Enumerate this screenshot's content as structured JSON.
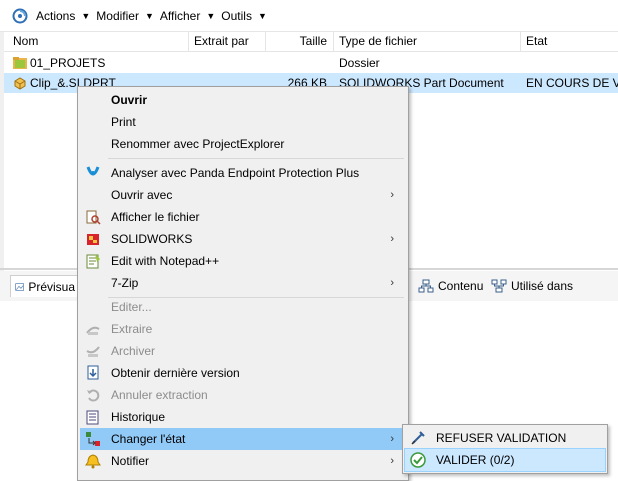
{
  "toolbar": {
    "app_icon": "vault-app-icon",
    "menus": [
      {
        "label": "Actions"
      },
      {
        "label": "Modifier"
      },
      {
        "label": "Afficher"
      },
      {
        "label": "Outils"
      }
    ]
  },
  "list": {
    "columns": [
      "Nom",
      "Extrait par",
      "Taille",
      "Type de fichier",
      "Etat"
    ],
    "rows": [
      {
        "name": "01_PROJETS",
        "checked_out_by": "",
        "size": "",
        "type": "Dossier",
        "state": "",
        "icon": "folder-icon"
      },
      {
        "name": "Clip_&.SLDPRT",
        "checked_out_by": "",
        "size": "266 KB",
        "type": "SOLIDWORKS Part Document",
        "state": "EN COURS DE VA",
        "icon": "solidworks-part-icon"
      }
    ]
  },
  "lower_panel": {
    "tabs": [
      {
        "label": "Prévisua"
      },
      {
        "label": "Contenu"
      },
      {
        "label": "Utilisé dans"
      }
    ]
  },
  "context_menu": {
    "items": [
      {
        "label": "Ouvrir",
        "bold": true
      },
      {
        "label": "Print"
      },
      {
        "label": "Renommer avec ProjectExplorer"
      },
      {
        "label": "Analyser avec Panda Endpoint Protection Plus",
        "icon": "panda-icon"
      },
      {
        "label": "Ouvrir avec",
        "submenu": true
      },
      {
        "label": "Afficher le fichier",
        "icon": "show-file-icon"
      },
      {
        "label": "SOLIDWORKS",
        "icon": "solidworks-icon",
        "submenu": true
      },
      {
        "label": "Edit with Notepad++",
        "icon": "notepad-icon"
      },
      {
        "label": "7-Zip",
        "submenu": true
      },
      {
        "label": "Editer...",
        "disabled": true
      },
      {
        "label": "Extraire",
        "disabled": true,
        "icon": "check-out-icon"
      },
      {
        "label": "Archiver",
        "disabled": true,
        "icon": "check-in-icon"
      },
      {
        "label": "Obtenir dernière version",
        "icon": "get-latest-icon"
      },
      {
        "label": "Annuler extraction",
        "disabled": true,
        "icon": "undo-checkout-icon"
      },
      {
        "label": "Historique",
        "icon": "history-icon"
      },
      {
        "label": "Changer l'état",
        "icon": "change-state-icon",
        "submenu": true,
        "highlighted": true
      },
      {
        "label": "Notifier",
        "icon": "bell-icon",
        "submenu": true
      }
    ],
    "submenu_arrow": "›"
  },
  "state_submenu": {
    "items": [
      {
        "label": "REFUSER VALIDATION",
        "icon": "reject-icon"
      },
      {
        "label": "VALIDER (0/2)",
        "icon": "approve-icon",
        "highlighted": true
      }
    ]
  },
  "colors": {
    "selection": "#cce8ff",
    "menu_highlight": "#91c9f7",
    "submenu_highlight": "#cce8ff",
    "folder": "#e8b64a",
    "solidworks_red": "#d8232a"
  }
}
